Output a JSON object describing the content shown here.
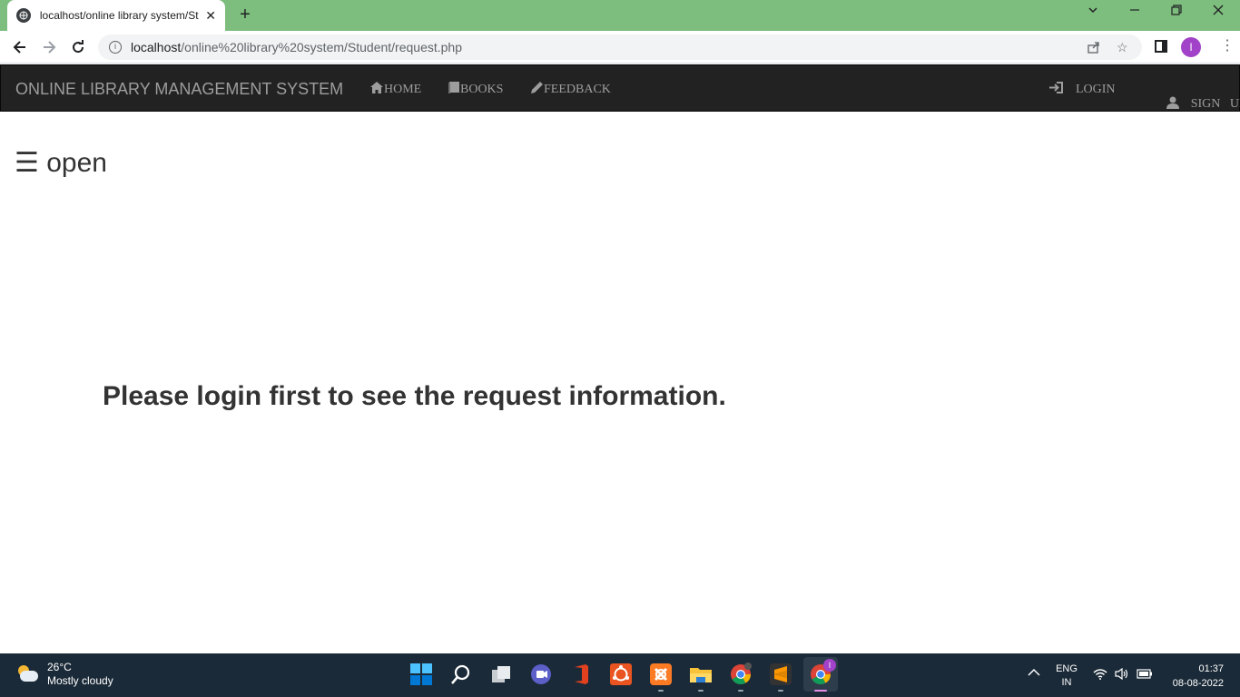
{
  "browser": {
    "tab_title": "localhost/online library system/St",
    "close_glyph": "✕",
    "new_tab_glyph": "+",
    "url_host": "localhost",
    "url_path": "/online%20library%20system/Student/request.php",
    "profile_initial": "I"
  },
  "navbar": {
    "brand": "ONLINE LIBRARY MANAGEMENT SYSTEM",
    "links": [
      {
        "label": "HOME",
        "icon": "home-icon"
      },
      {
        "label": "BOOKS",
        "icon": "book-icon"
      },
      {
        "label": "FEEDBACK",
        "icon": "pencil-icon"
      }
    ],
    "right_links": [
      {
        "label": "LOGIN",
        "icon": "login-icon"
      },
      {
        "label": "SIGN   UP",
        "icon": "user-icon"
      }
    ]
  },
  "page": {
    "opener": "☰ open",
    "message": "Please login first to see the request information."
  },
  "taskbar": {
    "weather_temp": "26°C",
    "weather_desc": "Mostly cloudy",
    "lang_top": "ENG",
    "lang_bottom": "IN",
    "time": "01:37",
    "date": "08-08-2022",
    "chrome_badge": "I"
  }
}
